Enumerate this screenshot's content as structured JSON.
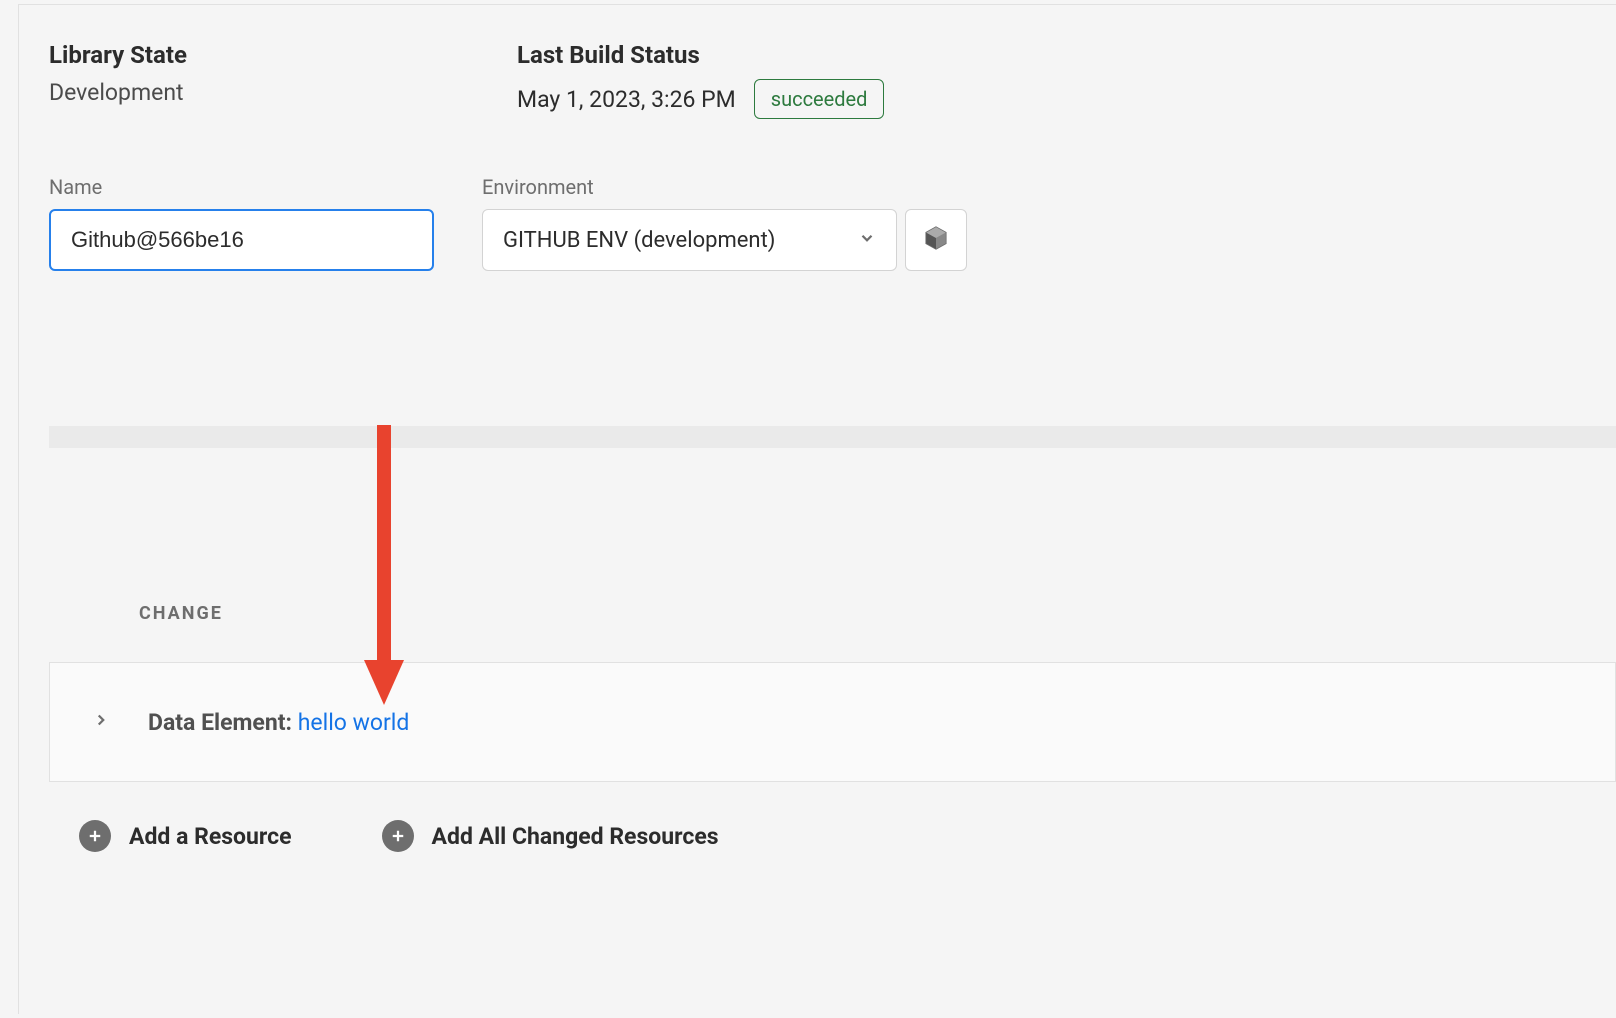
{
  "header": {
    "library_state_label": "Library State",
    "library_state_value": "Development",
    "last_build_label": "Last Build Status",
    "last_build_date": "May 1, 2023, 3:26 PM",
    "last_build_status": "succeeded"
  },
  "form": {
    "name_label": "Name",
    "name_value": "Github@566be16",
    "environment_label": "Environment",
    "environment_selected": "GITHUB ENV (development)"
  },
  "changes": {
    "section_label": "CHANGE",
    "items": [
      {
        "prefix": "Data Element: ",
        "link": "hello world"
      }
    ]
  },
  "actions": {
    "add_resource": "Add a Resource",
    "add_all_changed": "Add All Changed Resources"
  }
}
